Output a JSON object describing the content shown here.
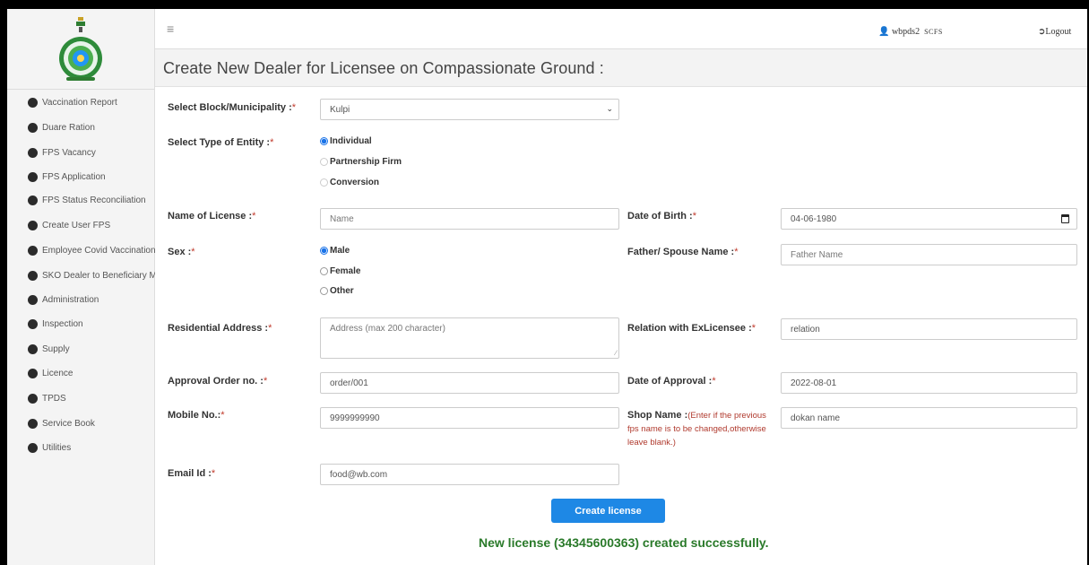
{
  "header": {
    "username": "wbpds2",
    "role": "SCFS",
    "logout_label": "Logout",
    "page_title": "Create New Dealer for Licensee on Compassionate Ground :"
  },
  "sidebar": {
    "items": [
      {
        "label": "Vaccination Report"
      },
      {
        "label": "Duare Ration"
      },
      {
        "label": "FPS Vacancy"
      },
      {
        "label": "FPS Application"
      },
      {
        "label": "FPS Status Reconciliation"
      },
      {
        "label": "Create User FPS"
      },
      {
        "label": "Employee Covid Vaccination"
      },
      {
        "label": "SKO Dealer to Beneficiary Ma"
      },
      {
        "label": "Administration"
      },
      {
        "label": "Inspection"
      },
      {
        "label": "Supply"
      },
      {
        "label": "Licence"
      },
      {
        "label": "TPDS"
      },
      {
        "label": "Service Book"
      },
      {
        "label": "Utilities"
      }
    ]
  },
  "form": {
    "block_label": "Select Block/Municipality :",
    "block_value": "Kulpi",
    "entity_label": "Select Type of Entity :",
    "entity_options": {
      "individual": "Individual",
      "partnership": "Partnership Firm",
      "conversion": "Conversion"
    },
    "entity_selected": "Individual",
    "license_name_label": "Name of License :",
    "license_name_placeholder": "Name",
    "dob_label": "Date of Birth :",
    "dob_value": "04-06-1980",
    "sex_label": "Sex :",
    "sex_options": {
      "male": "Male",
      "female": "Female",
      "other": "Other"
    },
    "sex_selected": "Male",
    "father_label": "Father/ Spouse Name :",
    "father_placeholder": "Father Name",
    "address_label": "Residential Address :",
    "address_placeholder": "Address (max 200 character)",
    "relation_label": "Relation with ExLicensee :",
    "relation_value": "relation",
    "approval_no_label": "Approval Order no. :",
    "approval_no_value": "order/001",
    "approval_date_label": "Date of Approval :",
    "approval_date_value": "2022-08-01",
    "mobile_label": "Mobile No.:",
    "mobile_value": "9999999990",
    "shop_label": "Shop Name :",
    "shop_note_1": "(Enter if the previous",
    "shop_note_2": "fps name is to be changed,otherwise",
    "shop_note_3": "leave blank.)",
    "shop_value": "dokan name",
    "email_label": "Email Id :",
    "email_value": "food@wb.com",
    "required_mark": "*",
    "submit_label": "Create license",
    "success_message": "New license (34345600363) created successfully."
  },
  "colors": {
    "primary_button": "#1e88e5",
    "success_text": "#2a7a2a",
    "required_mark": "#c0392b"
  }
}
